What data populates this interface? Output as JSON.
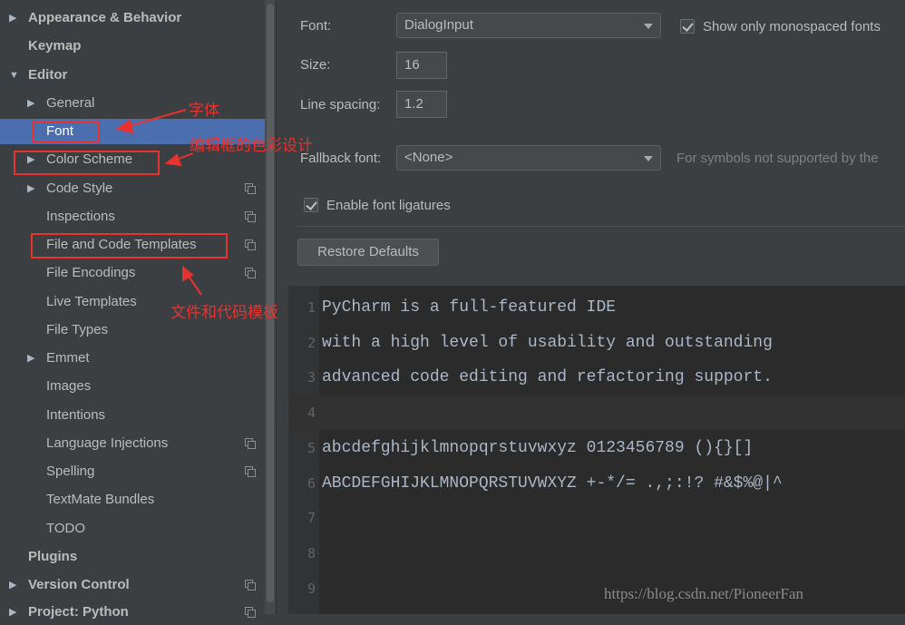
{
  "sidebar": {
    "items": [
      {
        "label": "Appearance & Behavior",
        "arrow": "▶"
      },
      {
        "label": "Keymap",
        "arrow": ""
      },
      {
        "label": "Editor",
        "arrow": "▼"
      },
      {
        "label": "General",
        "arrow": "▶"
      },
      {
        "label": "Font",
        "arrow": ""
      },
      {
        "label": "Color Scheme",
        "arrow": "▶"
      },
      {
        "label": "Code Style",
        "arrow": "▶"
      },
      {
        "label": "Inspections",
        "arrow": ""
      },
      {
        "label": "File and Code Templates",
        "arrow": ""
      },
      {
        "label": "File Encodings",
        "arrow": ""
      },
      {
        "label": "Live Templates",
        "arrow": ""
      },
      {
        "label": "File Types",
        "arrow": ""
      },
      {
        "label": "Emmet",
        "arrow": "▶"
      },
      {
        "label": "Images",
        "arrow": ""
      },
      {
        "label": "Intentions",
        "arrow": ""
      },
      {
        "label": "Language Injections",
        "arrow": ""
      },
      {
        "label": "Spelling",
        "arrow": ""
      },
      {
        "label": "TextMate Bundles",
        "arrow": ""
      },
      {
        "label": "TODO",
        "arrow": ""
      },
      {
        "label": "Plugins",
        "arrow": ""
      },
      {
        "label": "Version Control",
        "arrow": "▶"
      },
      {
        "label": "Project: Python",
        "arrow": "▶"
      }
    ]
  },
  "annotations": {
    "font": "字体",
    "color_scheme": "编辑框的色彩设计",
    "templates": "文件和代码模板"
  },
  "settings": {
    "font_label": "Font:",
    "font_value": "DialogInput",
    "mono_label": "Show only monospaced fonts",
    "size_label": "Size:",
    "size_value": "16",
    "line_spacing_label": "Line spacing:",
    "line_spacing_value": "1.2",
    "fallback_label": "Fallback font:",
    "fallback_value": "<None>",
    "fallback_hint": "For symbols not supported by the",
    "ligatures_label": "Enable font ligatures",
    "restore_label": "Restore Defaults"
  },
  "preview": {
    "lines": [
      {
        "num": "1",
        "text": "PyCharm is a full-featured IDE"
      },
      {
        "num": "2",
        "text": "with a high level of usability and outstanding"
      },
      {
        "num": "3",
        "text": "advanced code editing and refactoring support."
      },
      {
        "num": "4",
        "text": ""
      },
      {
        "num": "5",
        "text": "abcdefghijklmnopqrstuvwxyz 0123456789 (){}[]"
      },
      {
        "num": "6",
        "text": "ABCDEFGHIJKLMNOPQRSTUVWXYZ +-*/= .,;:!? #&$%@|^"
      },
      {
        "num": "7",
        "text": ""
      },
      {
        "num": "8",
        "text": ""
      },
      {
        "num": "9",
        "text": ""
      }
    ]
  },
  "watermark": "https://blog.csdn.net/PioneerFan",
  "colors": {
    "selection": "#4b6eaf",
    "annotation": "#e8322f",
    "panel": "#3c3f41",
    "editor": "#2b2b2b"
  }
}
